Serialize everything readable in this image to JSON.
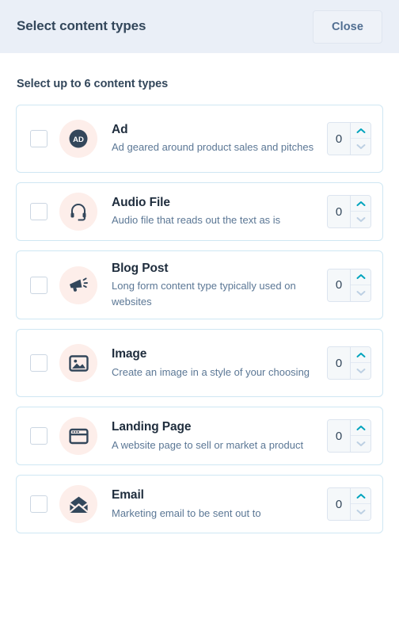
{
  "header": {
    "title": "Select content types",
    "close_label": "Close"
  },
  "body": {
    "section_title": "Select up to 6 content types"
  },
  "colors": {
    "header_bg": "#EAEFF7",
    "card_border": "#CFE7F3",
    "icon_bubble_bg": "#FDEEEA",
    "icon_fill": "#33475B",
    "title_text": "#33475B",
    "desc_text": "#5B7795",
    "stepper_up_arrow": "#00A4BD",
    "stepper_down_arrow": "#BDD0E3",
    "checkbox_border": "#CBD6E2"
  },
  "content_types": [
    {
      "name": "Ad",
      "description": "Ad geared around product sales and pitches",
      "icon": "ad-icon",
      "icon_label": "AD",
      "checked": false,
      "count": "0"
    },
    {
      "name": "Audio File",
      "description": "Audio file that reads out the text as is",
      "icon": "headset-icon",
      "checked": false,
      "count": "0"
    },
    {
      "name": "Blog Post",
      "description": "Long form content type typically used on websites",
      "icon": "megaphone-icon",
      "checked": false,
      "count": "0"
    },
    {
      "name": "Image",
      "description": "Create an image in a style of your choosing",
      "icon": "image-icon",
      "checked": false,
      "count": "0"
    },
    {
      "name": "Landing Page",
      "description": "A website page to sell or market a product",
      "icon": "browser-window-icon",
      "checked": false,
      "count": "0"
    },
    {
      "name": "Email",
      "description": "Marketing email to be sent out to",
      "icon": "open-envelope-icon",
      "checked": false,
      "count": "0"
    }
  ],
  "stepper": {
    "increment_label": "Increase",
    "decrement_label": "Decrease"
  }
}
